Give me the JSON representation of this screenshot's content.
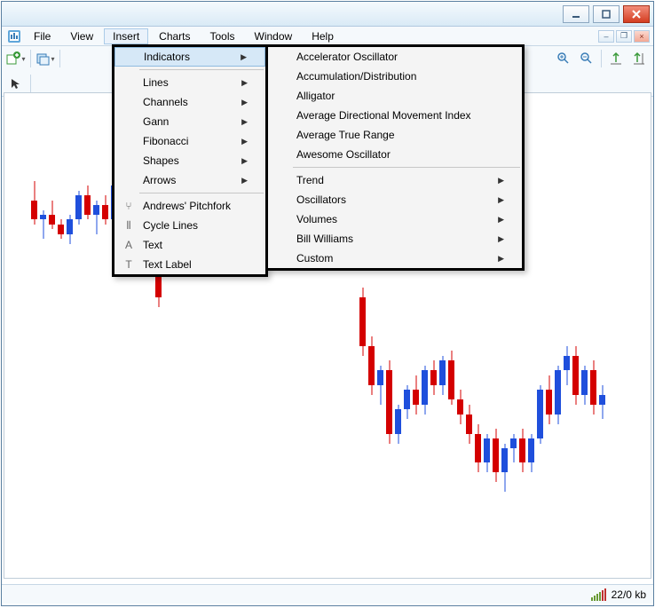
{
  "menubar": {
    "file": "File",
    "view": "View",
    "insert": "Insert",
    "charts": "Charts",
    "tools": "Tools",
    "window": "Window",
    "help": "Help"
  },
  "insert_menu": {
    "indicators": "Indicators",
    "lines": "Lines",
    "channels": "Channels",
    "gann": "Gann",
    "fibonacci": "Fibonacci",
    "shapes": "Shapes",
    "arrows": "Arrows",
    "andrews_pitchfork": "Andrews' Pitchfork",
    "cycle_lines": "Cycle Lines",
    "text": "Text",
    "text_label": "Text Label"
  },
  "indicators_menu": {
    "accelerator": "Accelerator Oscillator",
    "accumulation": "Accumulation/Distribution",
    "alligator": "Alligator",
    "adx": "Average Directional Movement Index",
    "atr": "Average True Range",
    "awesome": "Awesome Oscillator",
    "trend": "Trend",
    "oscillators": "Oscillators",
    "volumes": "Volumes",
    "bill_williams": "Bill Williams",
    "custom": "Custom"
  },
  "status": {
    "connection": "22/0 kb"
  },
  "chart_data": {
    "type": "candlestick",
    "note": "Approximate OHLC candles read from pixels; relative scale 0-100 (0=bottom of chart)",
    "candles": [
      {
        "x": 3,
        "o": 78,
        "h": 82,
        "l": 73,
        "c": 74,
        "dir": "down"
      },
      {
        "x": 4,
        "o": 74,
        "h": 76,
        "l": 70,
        "c": 75,
        "dir": "up"
      },
      {
        "x": 5,
        "o": 75,
        "h": 78,
        "l": 72,
        "c": 73,
        "dir": "down"
      },
      {
        "x": 6,
        "o": 73,
        "h": 74,
        "l": 70,
        "c": 71,
        "dir": "down"
      },
      {
        "x": 7,
        "o": 71,
        "h": 75,
        "l": 69,
        "c": 74,
        "dir": "up"
      },
      {
        "x": 8,
        "o": 74,
        "h": 80,
        "l": 73,
        "c": 79,
        "dir": "up"
      },
      {
        "x": 9,
        "o": 79,
        "h": 81,
        "l": 74,
        "c": 75,
        "dir": "down"
      },
      {
        "x": 10,
        "o": 75,
        "h": 78,
        "l": 71,
        "c": 77,
        "dir": "up"
      },
      {
        "x": 11,
        "o": 77,
        "h": 79,
        "l": 73,
        "c": 74,
        "dir": "down"
      },
      {
        "x": 12,
        "o": 74,
        "h": 82,
        "l": 72,
        "c": 81,
        "dir": "up"
      },
      {
        "x": 13,
        "o": 81,
        "h": 83,
        "l": 76,
        "c": 77,
        "dir": "down"
      },
      {
        "x": 14,
        "o": 77,
        "h": 79,
        "l": 68,
        "c": 70,
        "dir": "down"
      },
      {
        "x": 15,
        "o": 70,
        "h": 77,
        "l": 68,
        "c": 76,
        "dir": "up"
      },
      {
        "x": 16,
        "o": 76,
        "h": 80,
        "l": 74,
        "c": 79,
        "dir": "up"
      },
      {
        "x": 17,
        "o": 79,
        "h": 82,
        "l": 56,
        "c": 58,
        "dir": "down"
      },
      {
        "x": 40,
        "o": 58,
        "h": 60,
        "l": 46,
        "c": 48,
        "dir": "down"
      },
      {
        "x": 41,
        "o": 48,
        "h": 50,
        "l": 38,
        "c": 40,
        "dir": "down"
      },
      {
        "x": 42,
        "o": 40,
        "h": 44,
        "l": 36,
        "c": 43,
        "dir": "up"
      },
      {
        "x": 43,
        "o": 43,
        "h": 45,
        "l": 28,
        "c": 30,
        "dir": "down"
      },
      {
        "x": 44,
        "o": 30,
        "h": 36,
        "l": 28,
        "c": 35,
        "dir": "up"
      },
      {
        "x": 45,
        "o": 35,
        "h": 40,
        "l": 33,
        "c": 39,
        "dir": "up"
      },
      {
        "x": 46,
        "o": 39,
        "h": 42,
        "l": 34,
        "c": 36,
        "dir": "down"
      },
      {
        "x": 47,
        "o": 36,
        "h": 44,
        "l": 34,
        "c": 43,
        "dir": "up"
      },
      {
        "x": 48,
        "o": 43,
        "h": 45,
        "l": 38,
        "c": 40,
        "dir": "down"
      },
      {
        "x": 49,
        "o": 40,
        "h": 46,
        "l": 38,
        "c": 45,
        "dir": "up"
      },
      {
        "x": 50,
        "o": 45,
        "h": 47,
        "l": 36,
        "c": 37,
        "dir": "down"
      },
      {
        "x": 51,
        "o": 37,
        "h": 39,
        "l": 32,
        "c": 34,
        "dir": "down"
      },
      {
        "x": 52,
        "o": 34,
        "h": 36,
        "l": 28,
        "c": 30,
        "dir": "down"
      },
      {
        "x": 53,
        "o": 30,
        "h": 32,
        "l": 22,
        "c": 24,
        "dir": "down"
      },
      {
        "x": 54,
        "o": 24,
        "h": 30,
        "l": 22,
        "c": 29,
        "dir": "up"
      },
      {
        "x": 55,
        "o": 29,
        "h": 31,
        "l": 20,
        "c": 22,
        "dir": "down"
      },
      {
        "x": 56,
        "o": 22,
        "h": 28,
        "l": 18,
        "c": 27,
        "dir": "up"
      },
      {
        "x": 57,
        "o": 27,
        "h": 30,
        "l": 24,
        "c": 29,
        "dir": "up"
      },
      {
        "x": 58,
        "o": 29,
        "h": 31,
        "l": 22,
        "c": 24,
        "dir": "down"
      },
      {
        "x": 59,
        "o": 24,
        "h": 30,
        "l": 22,
        "c": 29,
        "dir": "up"
      },
      {
        "x": 60,
        "o": 29,
        "h": 40,
        "l": 28,
        "c": 39,
        "dir": "up"
      },
      {
        "x": 61,
        "o": 39,
        "h": 42,
        "l": 32,
        "c": 34,
        "dir": "down"
      },
      {
        "x": 62,
        "o": 34,
        "h": 44,
        "l": 32,
        "c": 43,
        "dir": "up"
      },
      {
        "x": 63,
        "o": 43,
        "h": 48,
        "l": 40,
        "c": 46,
        "dir": "up"
      },
      {
        "x": 64,
        "o": 46,
        "h": 48,
        "l": 36,
        "c": 38,
        "dir": "down"
      },
      {
        "x": 65,
        "o": 38,
        "h": 44,
        "l": 36,
        "c": 43,
        "dir": "up"
      },
      {
        "x": 66,
        "o": 43,
        "h": 45,
        "l": 34,
        "c": 36,
        "dir": "down"
      },
      {
        "x": 67,
        "o": 36,
        "h": 40,
        "l": 33,
        "c": 38,
        "dir": "up"
      }
    ]
  }
}
